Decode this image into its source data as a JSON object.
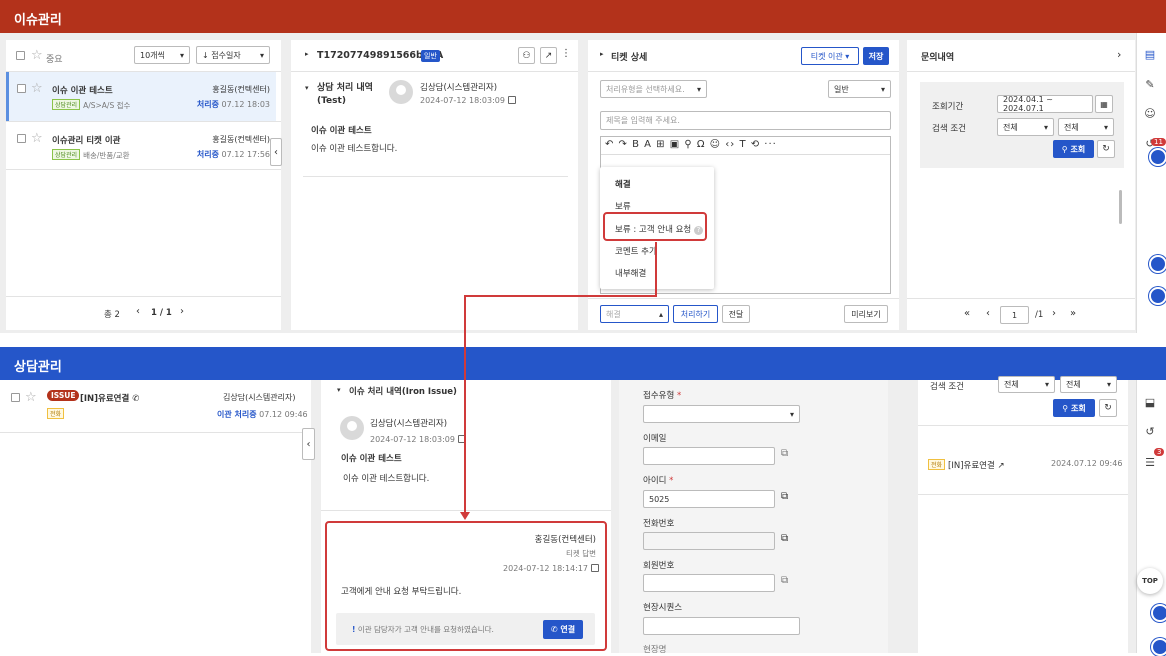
{
  "top_bar": {
    "title": "이슈관리"
  },
  "bottom_bar": {
    "title": "상담관리"
  },
  "issue_list": {
    "favorites_label": "중요",
    "page_size": "10개씩",
    "sort": "↓ 접수일자",
    "items": [
      {
        "title": "이슈 이관 테스트",
        "tag": "상담관리",
        "category": "A/S>A/S 접수",
        "owner": "홍길동(컨텍센터)",
        "status": "처리중",
        "date": "07.12 18:03"
      },
      {
        "title": "이슈관리 티켓 이관",
        "tag": "상담관리",
        "category": "배송/반품/교환",
        "owner": "홍길동(컨텍센터)",
        "status": "처리중",
        "date": "07.12 17:56"
      }
    ],
    "total": "총 2",
    "pagination": "1 / 1"
  },
  "ticket_panel": {
    "ticket_id": "T17207749891566bUFA",
    "badge": "일반",
    "section_title": "상담 처리 내역\n(Test)",
    "author": "김상담(시스템관리자)",
    "timestamp": "2024-07-12 18:03:09",
    "content_title": "이슈 이관 테스트",
    "content_body": "이슈 이관 테스트합니다."
  },
  "ticket_detail": {
    "title": "티켓 상세",
    "transfer_btn": "티켓 이관 ▾",
    "save_btn": "저장",
    "type_placeholder": "처리유형을 선택하세요.",
    "general": "일반",
    "title_placeholder": "제목을 입력해 주세요.",
    "toolbar_icons": "↶ ↷ B A ⊞ ▣ ⚲ Ω ☺ ‹› T ⟲ ···",
    "menu": [
      "해결",
      "보류",
      "보류 : 고객 안내 요청",
      "코멘트 추가",
      "내부해결"
    ],
    "status_select": "해결",
    "process_btn": "처리하기",
    "forward_btn": "전달",
    "preview_btn": "미리보기"
  },
  "inquiry_panel": {
    "title": "문의내역",
    "period_label": "조회기간",
    "period_value": "2024.04.1 ~ 2024.07.1",
    "search_label": "검색 조건",
    "opt1": "전체",
    "opt2": "전체",
    "search_btn": "조회",
    "page": "1",
    "page_total": "/1"
  },
  "right_rail": {
    "badge1": "11",
    "badge2": "3",
    "top": "TOP"
  },
  "counsel_list": {
    "issue_badge": "ISSUE",
    "title": "[IN]유료연결",
    "tag": "전화",
    "owner": "김상담(시스템관리자)",
    "status": "이관 처리중",
    "date": "07.12 09:46"
  },
  "counsel_history": {
    "section_title": "이슈 처리 내역(Iron Issue)",
    "author": "김상담(시스템관리자)",
    "timestamp": "2024-07-12 18:03:09",
    "content_title": "이슈 이관 테스트",
    "content_body": "이슈 이관 테스트합니다.",
    "reply_author": "홍길동(컨텍센터)",
    "reply_type": "티켓 답변",
    "reply_time": "2024-07-12 18:14:17",
    "reply_body": "고객에게 안내 요청 부탁드립니다.",
    "notice": "이관 담당자가 고객 안내를 요청하였습니다.",
    "connect_btn": "연결"
  },
  "form": {
    "type_label": "접수유형",
    "email_label": "이메일",
    "id_label": "아이디",
    "id_value": "5025",
    "phone_label": "전화번호",
    "member_label": "회원번호",
    "seq_label": "현장시퀀스",
    "next_label": "현장명"
  },
  "counsel_right": {
    "search_label": "검색 조건",
    "opt1": "전체",
    "opt2": "전체",
    "search_btn": "조회",
    "item_tag": "전화",
    "item_title": "[IN]유료연결",
    "item_date": "2024.07.12 09:46"
  }
}
